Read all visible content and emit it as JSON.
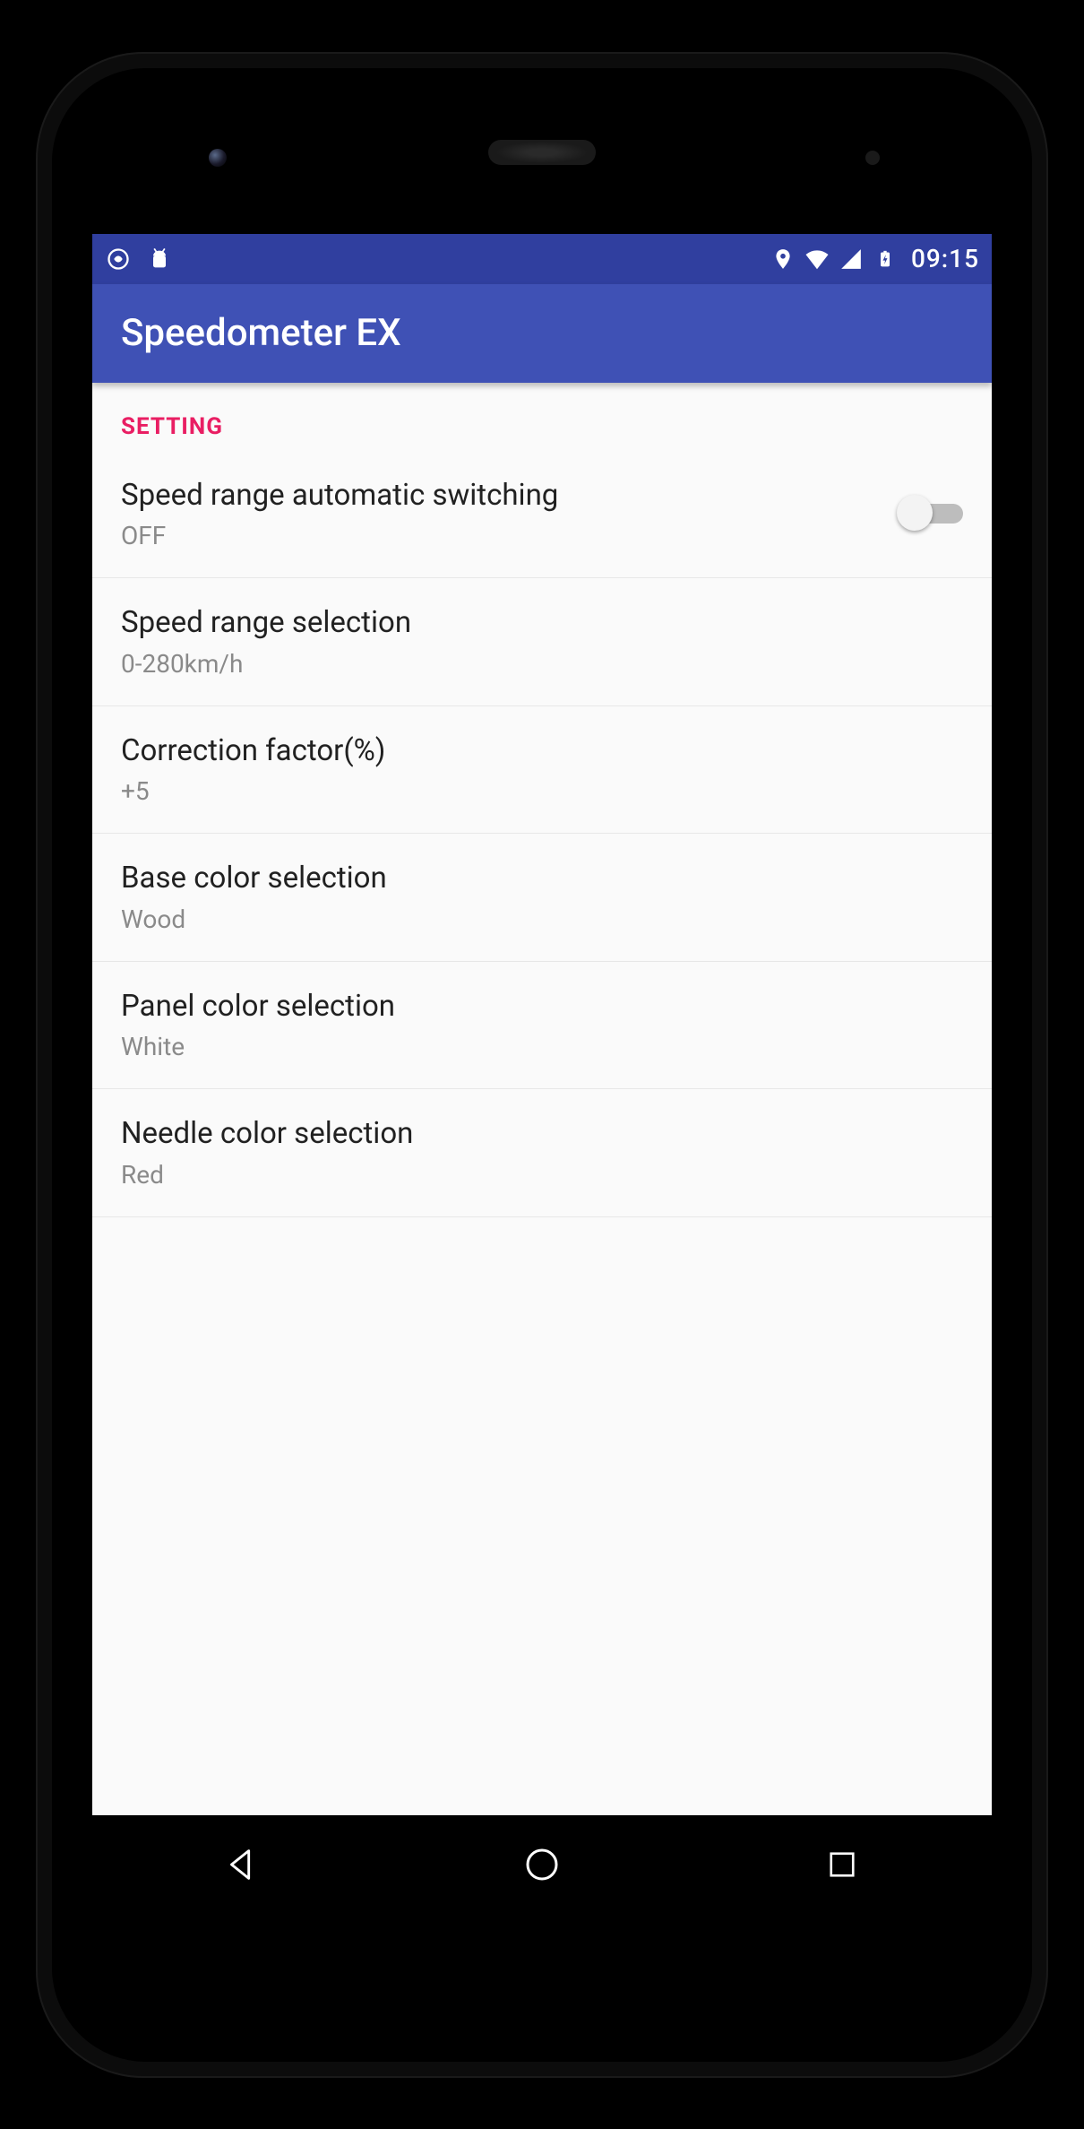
{
  "status": {
    "time": "09:15",
    "icons_left": [
      "sync-icon",
      "android-icon"
    ],
    "icons_right": [
      "location-icon",
      "wifi-icon",
      "cell-icon",
      "battery-charging-icon"
    ]
  },
  "appbar": {
    "title": "Speedometer EX"
  },
  "section": {
    "header": "SETTING"
  },
  "settings": {
    "auto_switch": {
      "title": "Speed range automatic switching",
      "value": "OFF",
      "on": false
    },
    "range": {
      "title": "Speed range selection",
      "value": "0-280km/h"
    },
    "correction": {
      "title": "Correction factor(%)",
      "value": "+5"
    },
    "base_color": {
      "title": "Base color selection",
      "value": "Wood"
    },
    "panel_color": {
      "title": "Panel color selection",
      "value": "White"
    },
    "needle_color": {
      "title": "Needle color selection",
      "value": "Red"
    }
  }
}
